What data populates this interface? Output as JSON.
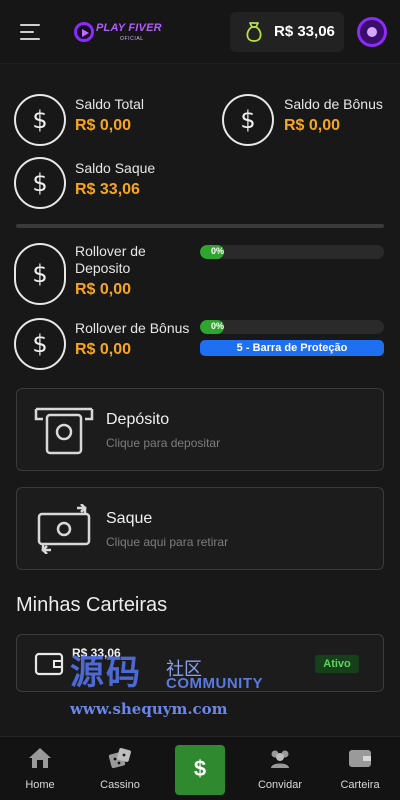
{
  "header": {
    "logo_name": "PLAY FIVER",
    "logo_sub": "OFICIAL",
    "wallet_amount": "R$ 33,06"
  },
  "balances": {
    "total_label": "Saldo Total",
    "total_value": "R$ 0,00",
    "bonus_label": "Saldo de Bônus",
    "bonus_value": "R$ 0,00",
    "withdraw_label": "Saldo Saque",
    "withdraw_value": "R$ 33,06"
  },
  "rollover": {
    "deposit_label": "Rollover de Deposito",
    "deposit_value": "R$ 0,00",
    "deposit_progress": "0%",
    "bonus_label": "Rollover de Bônus",
    "bonus_value": "R$ 0,00",
    "bonus_progress": "0%",
    "protection_bar": "5 - Barra de Proteção"
  },
  "actions": {
    "deposit_title": "Depósito",
    "deposit_subtitle": "Clique para depositar",
    "withdraw_title": "Saque",
    "withdraw_subtitle": "Clique aqui para retirar"
  },
  "wallets": {
    "section_title": "Minhas Carteiras",
    "items": [
      {
        "amount": "R$ 33,06",
        "status": "Ativo"
      }
    ]
  },
  "watermark": {
    "cn_big": "源码",
    "cn_small": "社区",
    "community": "COMMUNITY",
    "url": "www.shequym.com"
  },
  "nav": {
    "home": "Home",
    "casino": "Cassino",
    "center_symbol": "$",
    "invite": "Convidar",
    "wallet": "Carteira"
  },
  "colors": {
    "accent_orange": "#f5a623",
    "progress_green": "#2fa52f",
    "protection_blue": "#1e6ff2",
    "brand_purple": "#8b2cf5"
  }
}
